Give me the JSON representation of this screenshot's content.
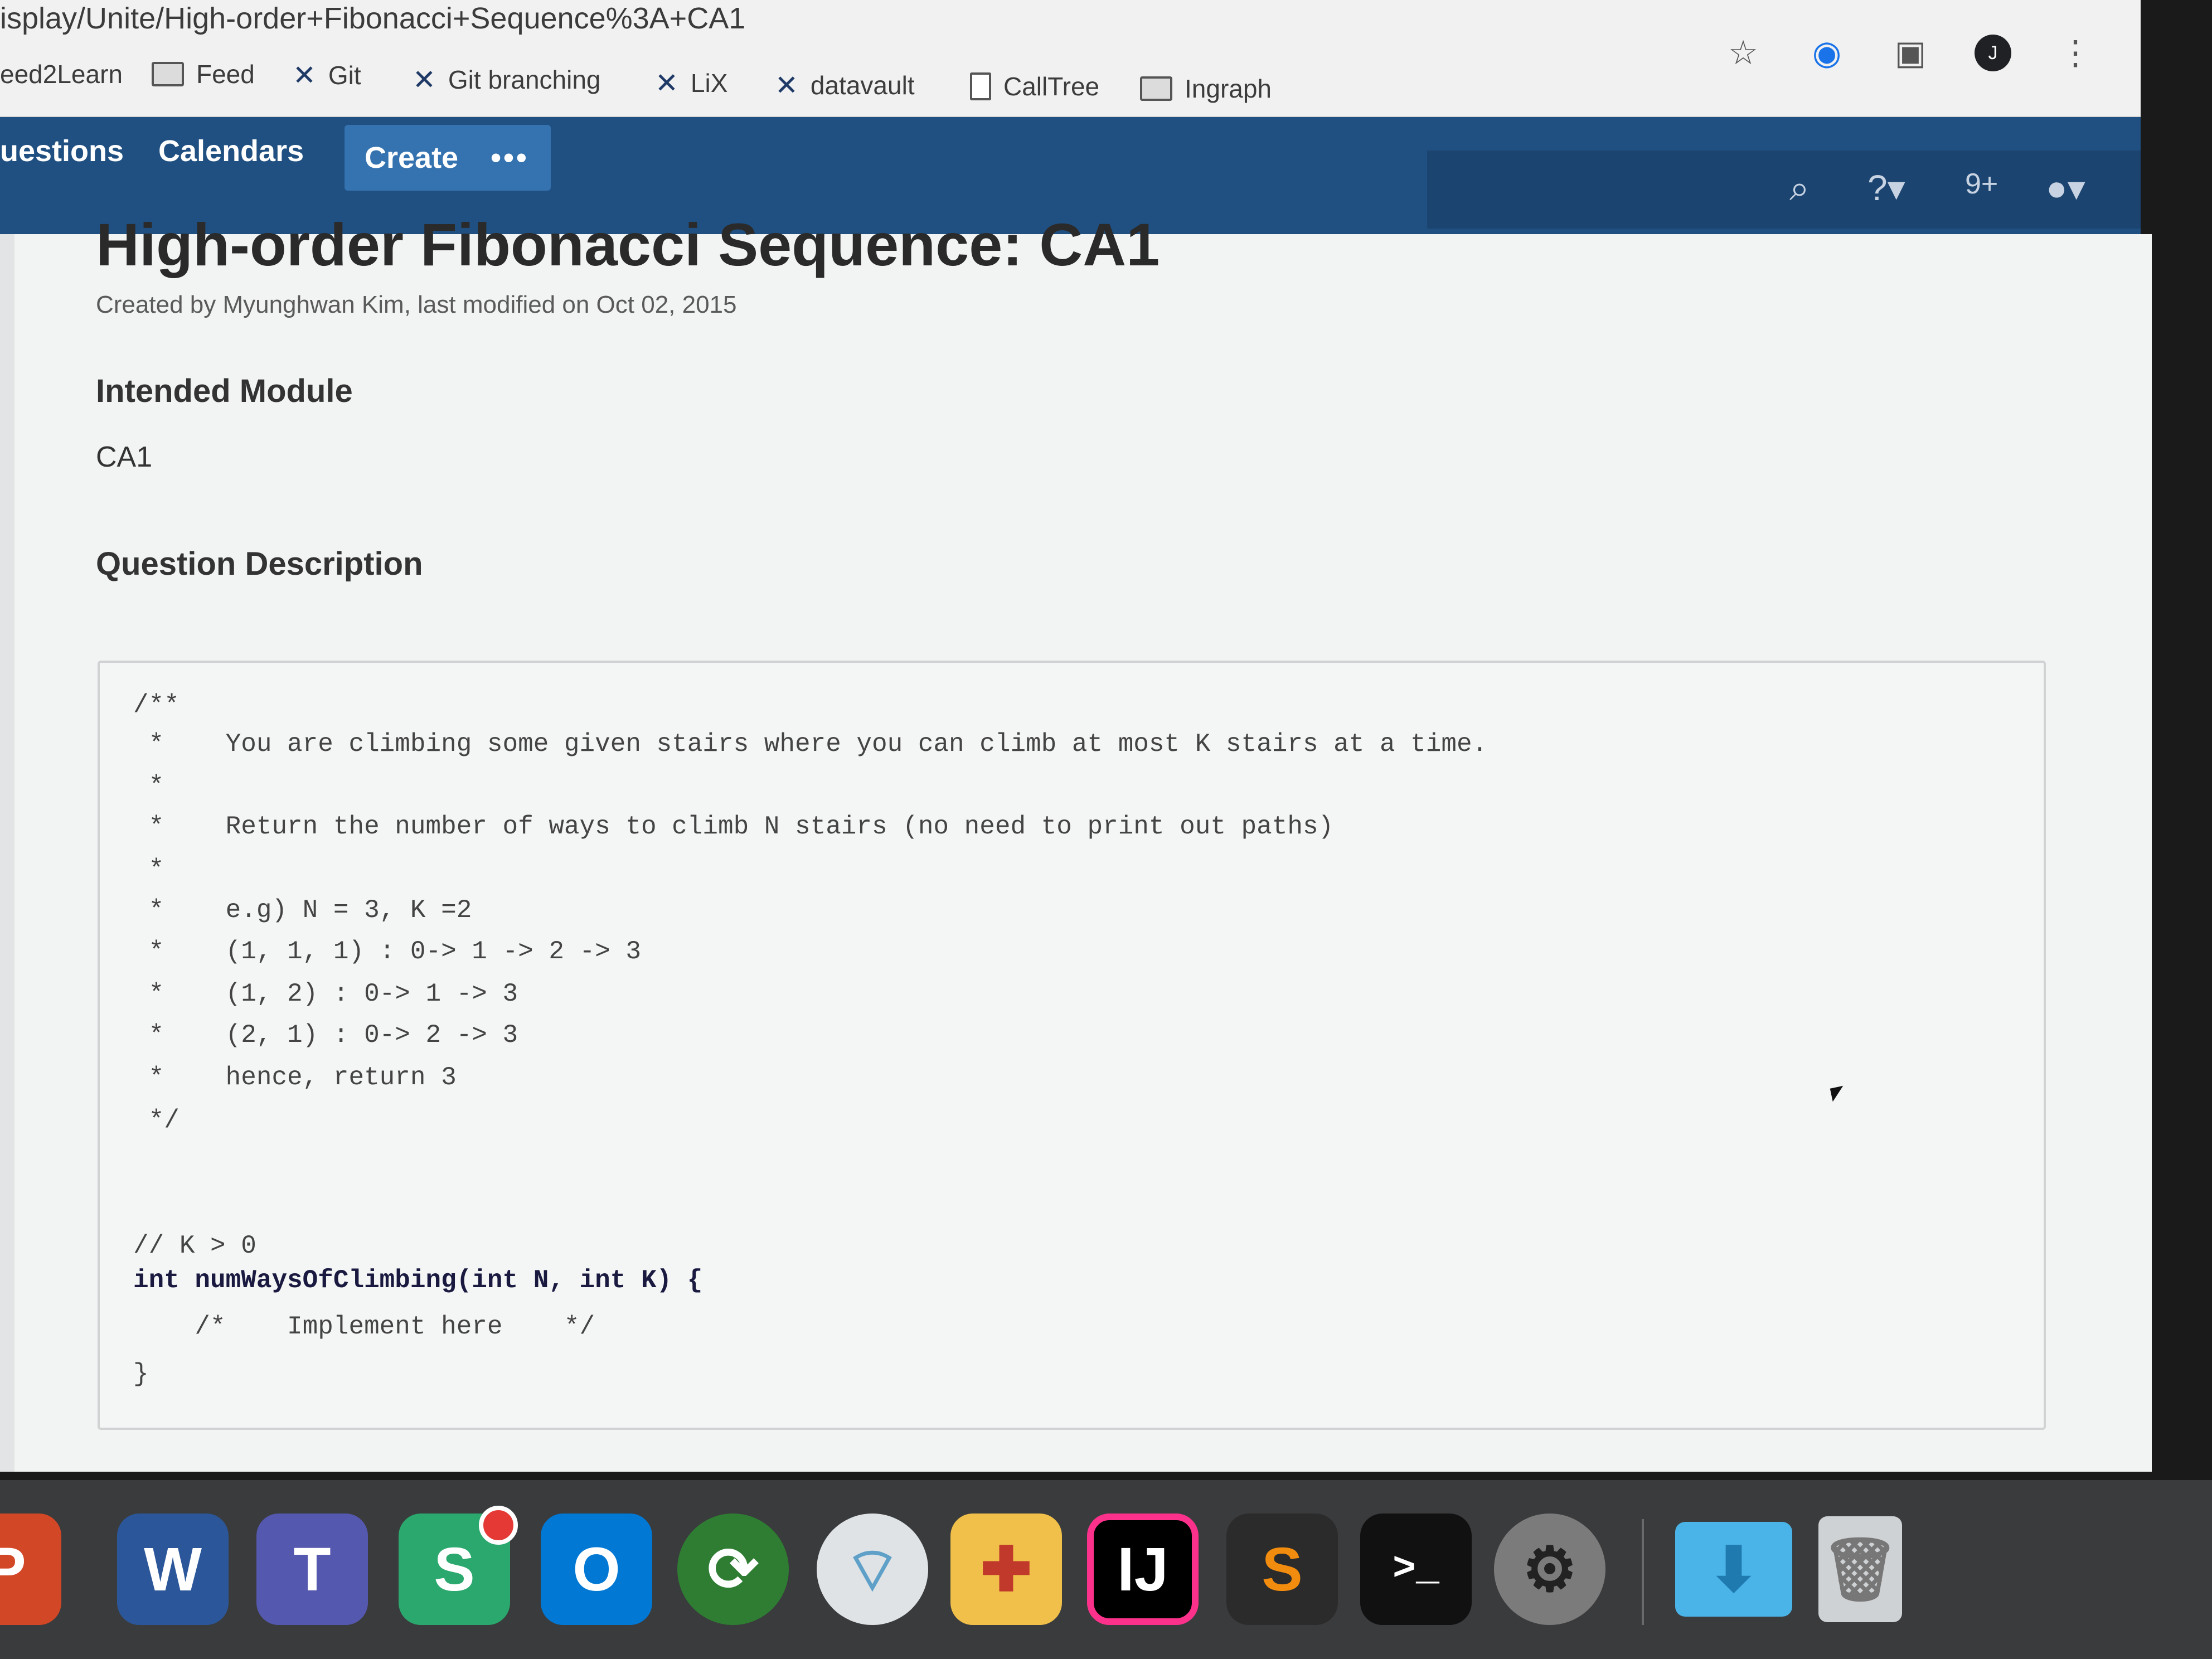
{
  "browser": {
    "url": "isplay/Unite/High-order+Fibonacci+Sequence%3A+CA1",
    "bookmarks": [
      {
        "label": "eed2Learn",
        "icon": "none"
      },
      {
        "label": "Feed",
        "icon": "folder-icon"
      },
      {
        "label": "Git",
        "icon": "linkedin-x-icon"
      },
      {
        "label": "Git branching",
        "icon": "linkedin-x-icon"
      },
      {
        "label": "LiX",
        "icon": "linkedin-x-icon"
      },
      {
        "label": "datavault",
        "icon": "linkedin-x-icon"
      },
      {
        "label": "CallTree",
        "icon": "page-icon"
      },
      {
        "label": "Ingraph",
        "icon": "folder-icon"
      }
    ],
    "profile_initial": "J"
  },
  "nav": {
    "items": [
      "uestions",
      "Calendars"
    ],
    "create_label": "Create",
    "more_label": "•••",
    "notification_count": "9+"
  },
  "page": {
    "title": "High-order Fibonacci Sequence: CA1",
    "byline": "Created by Myunghwan Kim, last modified on Oct 02, 2015",
    "section1_heading": "Intended Module",
    "section1_body": "CA1",
    "section2_heading": "Question Description"
  },
  "code": {
    "lines": [
      "/**",
      " *    You are climbing some given stairs where you can climb at most K stairs at a time.",
      " *",
      " *    Return the number of ways to climb N stairs (no need to print out paths)",
      " *",
      " *    e.g) N = 3, K =2",
      " *    (1, 1, 1) : 0-> 1 -> 2 -> 3",
      " *    (1, 2) : 0-> 1 -> 3",
      " *    (2, 1) : 0-> 2 -> 3",
      " *    hence, return 3",
      " */",
      "",
      "",
      "// K > 0",
      "int numWaysOfClimbing(int N, int K) {",
      "    /*    Implement here    */",
      "}"
    ]
  },
  "dock": {
    "apps": [
      "powerpoint-icon",
      "word-icon",
      "teams-icon",
      "slack-icon",
      "outlook-icon",
      "vpn-icon",
      "wifi-icon",
      "self-service-icon",
      "intellij-icon",
      "sublime-icon",
      "terminal-icon",
      "system-preferences-icon",
      "downloads-folder-icon",
      "trash-icon"
    ]
  }
}
